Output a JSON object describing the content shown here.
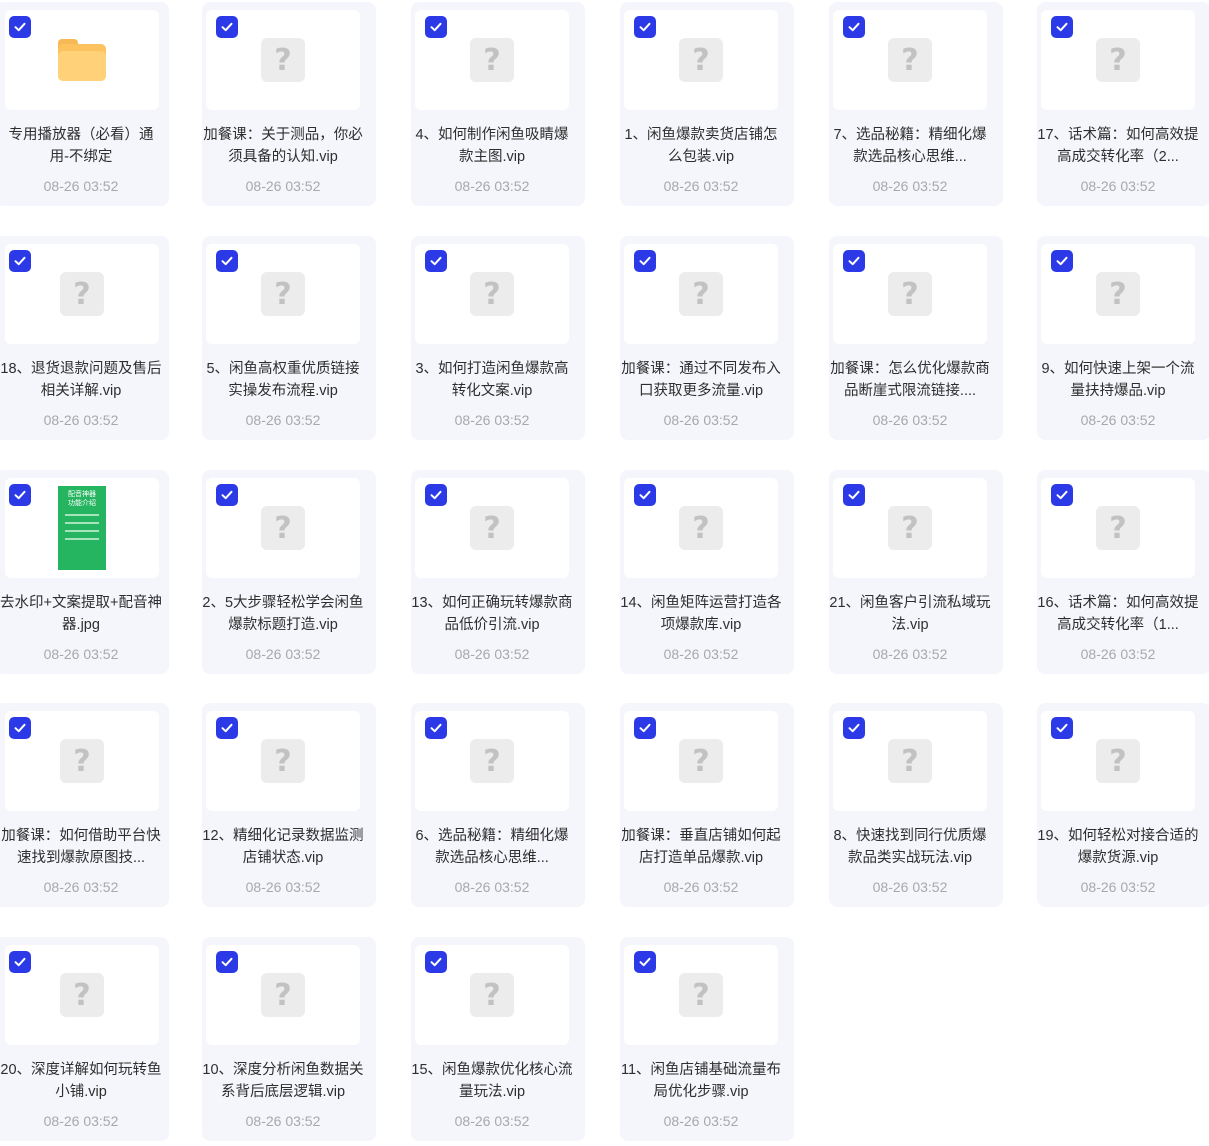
{
  "files": [
    {
      "name": "专用播放器（必看）通用-不绑定",
      "date": "08-26 03:52",
      "thumb": "folder-icon",
      "checked": true
    },
    {
      "name": "加餐课：关于测品，你必须具备的认知.vip",
      "date": "08-26 03:52",
      "thumb": "unknown-file-icon",
      "checked": true
    },
    {
      "name": "4、如何制作闲鱼吸睛爆款主图.vip",
      "date": "08-26 03:52",
      "thumb": "unknown-file-icon",
      "checked": true
    },
    {
      "name": "1、闲鱼爆款卖货店铺怎么包装.vip",
      "date": "08-26 03:52",
      "thumb": "unknown-file-icon",
      "checked": true
    },
    {
      "name": "7、选品秘籍：精细化爆款选品核心思维...",
      "date": "08-26 03:52",
      "thumb": "unknown-file-icon",
      "checked": true
    },
    {
      "name": "17、话术篇：如何高效提高成交转化率（2...",
      "date": "08-26 03:52",
      "thumb": "unknown-file-icon",
      "checked": true
    },
    {
      "name": "18、退货退款问题及售后相关详解.vip",
      "date": "08-26 03:52",
      "thumb": "unknown-file-icon",
      "checked": true
    },
    {
      "name": "5、闲鱼高权重优质链接实操发布流程.vip",
      "date": "08-26 03:52",
      "thumb": "unknown-file-icon",
      "checked": true
    },
    {
      "name": "3、如何打造闲鱼爆款高转化文案.vip",
      "date": "08-26 03:52",
      "thumb": "unknown-file-icon",
      "checked": true
    },
    {
      "name": "加餐课：通过不同发布入口获取更多流量.vip",
      "date": "08-26 03:52",
      "thumb": "unknown-file-icon",
      "checked": true
    },
    {
      "name": "加餐课：怎么优化爆款商品断崖式限流链接....",
      "date": "08-26 03:52",
      "thumb": "unknown-file-icon",
      "checked": true
    },
    {
      "name": "9、如何快速上架一个流量扶持爆品.vip",
      "date": "08-26 03:52",
      "thumb": "unknown-file-icon",
      "checked": true
    },
    {
      "name": "去水印+文案提取+配音神器.jpg",
      "date": "08-26 03:52",
      "thumb": "image-thumbnail",
      "thumb_text": "配音神器\n功能介绍",
      "checked": true
    },
    {
      "name": "2、5大步骤轻松学会闲鱼爆款标题打造.vip",
      "date": "08-26 03:52",
      "thumb": "unknown-file-icon",
      "checked": true
    },
    {
      "name": "13、如何正确玩转爆款商品低价引流.vip",
      "date": "08-26 03:52",
      "thumb": "unknown-file-icon",
      "checked": true
    },
    {
      "name": "14、闲鱼矩阵运营打造各项爆款库.vip",
      "date": "08-26 03:52",
      "thumb": "unknown-file-icon",
      "checked": true
    },
    {
      "name": "21、闲鱼客户引流私域玩法.vip",
      "date": "08-26 03:52",
      "thumb": "unknown-file-icon",
      "checked": true
    },
    {
      "name": "16、话术篇：如何高效提高成交转化率（1...",
      "date": "08-26 03:52",
      "thumb": "unknown-file-icon",
      "checked": true
    },
    {
      "name": "加餐课：如何借助平台快速找到爆款原图技...",
      "date": "08-26 03:52",
      "thumb": "unknown-file-icon",
      "checked": true
    },
    {
      "name": "12、精细化记录数据监测店铺状态.vip",
      "date": "08-26 03:52",
      "thumb": "unknown-file-icon",
      "checked": true
    },
    {
      "name": "6、选品秘籍：精细化爆款选品核心思维...",
      "date": "08-26 03:52",
      "thumb": "unknown-file-icon",
      "checked": true
    },
    {
      "name": "加餐课：垂直店铺如何起店打造单品爆款.vip",
      "date": "08-26 03:52",
      "thumb": "unknown-file-icon",
      "checked": true
    },
    {
      "name": "8、快速找到同行优质爆款品类实战玩法.vip",
      "date": "08-26 03:52",
      "thumb": "unknown-file-icon",
      "checked": true
    },
    {
      "name": "19、如何轻松对接合适的爆款货源.vip",
      "date": "08-26 03:52",
      "thumb": "unknown-file-icon",
      "checked": true
    },
    {
      "name": "20、深度详解如何玩转鱼小铺.vip",
      "date": "08-26 03:52",
      "thumb": "unknown-file-icon",
      "checked": true
    },
    {
      "name": "10、深度分析闲鱼数据关系背后底层逻辑.vip",
      "date": "08-26 03:52",
      "thumb": "unknown-file-icon",
      "checked": true
    },
    {
      "name": "15、闲鱼爆款优化核心流量玩法.vip",
      "date": "08-26 03:52",
      "thumb": "unknown-file-icon",
      "checked": true
    },
    {
      "name": "11、闲鱼店铺基础流量布局优化步骤.vip",
      "date": "08-26 03:52",
      "thumb": "unknown-file-icon",
      "checked": true
    }
  ],
  "colors": {
    "checkbox": "#2b3ae6",
    "card_bg": "#f5f6fc",
    "date_text": "#a7a8ad"
  }
}
